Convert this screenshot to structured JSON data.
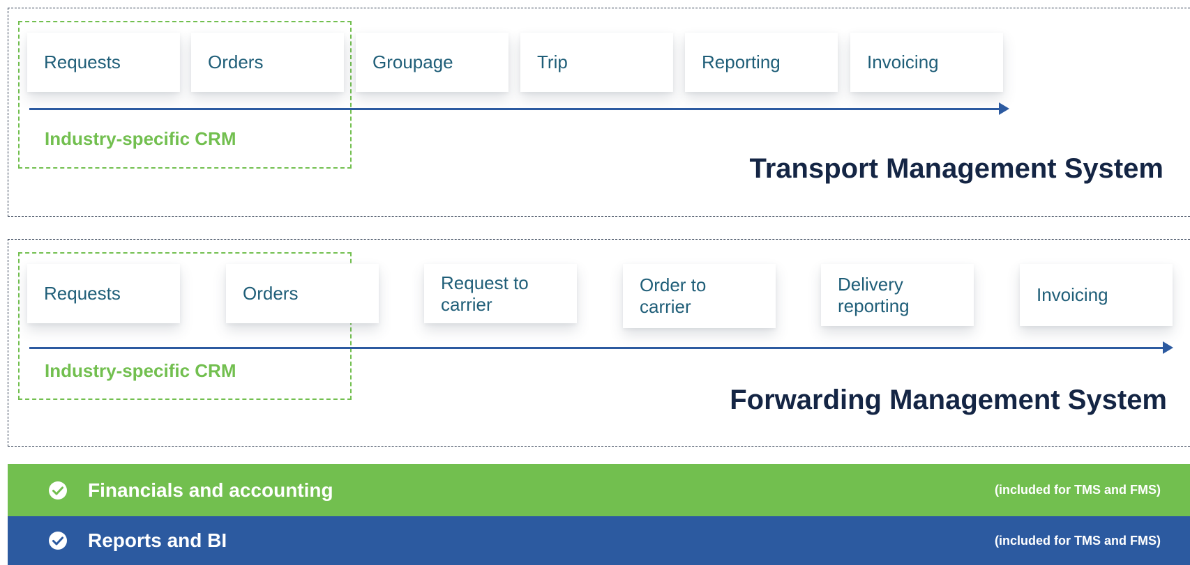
{
  "tms": {
    "title": "Transport Management System",
    "crm_label": "Industry-specific CRM",
    "steps": [
      "Requests",
      "Orders",
      "Groupage",
      "Trip",
      "Reporting",
      "Invoicing"
    ]
  },
  "fms": {
    "title": "Forwarding Management System",
    "crm_label": "Industry-specific CRM",
    "steps": [
      "Requests",
      "Orders",
      "Request to carrier",
      "Order to carrier",
      "Delivery reporting",
      "Invoicing"
    ]
  },
  "features": [
    {
      "label": "Financials and accounting",
      "note": "(included for TMS and FMS)",
      "color": "#72bf4f",
      "icon": "check-circle-icon"
    },
    {
      "label": "Reports and BI",
      "note": "(included for TMS and FMS)",
      "color": "#2c5aa0",
      "icon": "check-circle-icon"
    }
  ],
  "colors": {
    "crm_green": "#72bf4f",
    "arrow_blue": "#2c5aa0",
    "title_navy": "#142544",
    "card_text": "#1f5e78"
  }
}
